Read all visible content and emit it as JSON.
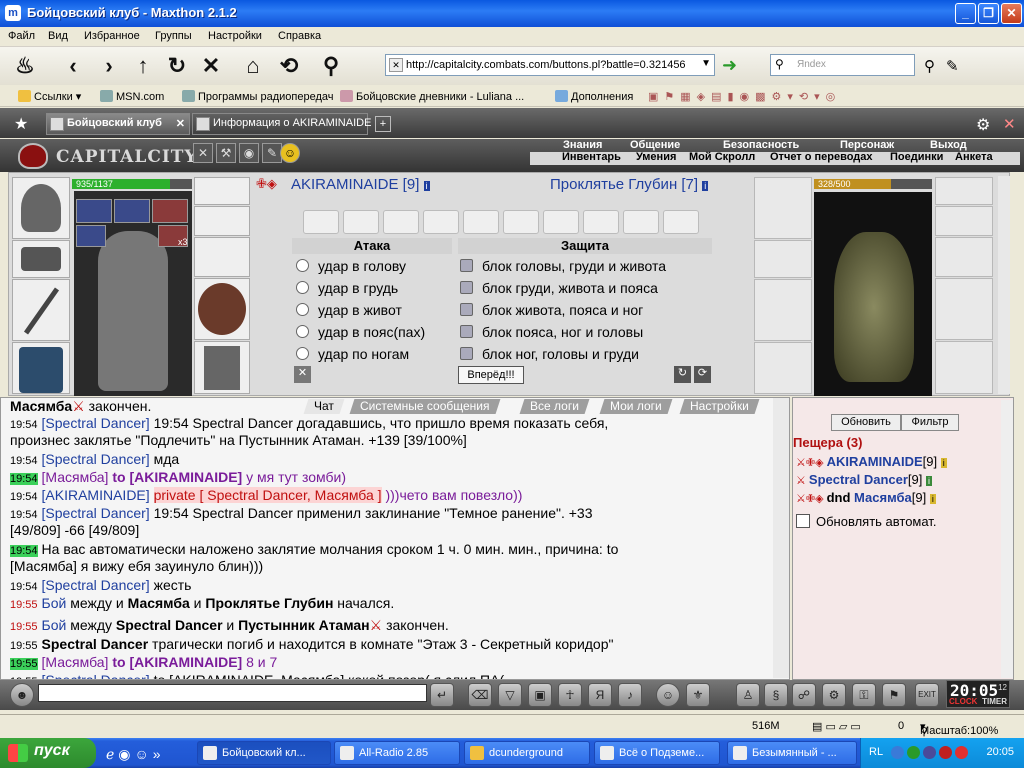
{
  "window": {
    "title": "Бойцовский клуб - Maxthon 2.1.2",
    "app_icon": "m"
  },
  "menu": [
    "Файл",
    "Вид",
    "Избранное",
    "Группы",
    "Настройки",
    "Справка"
  ],
  "address": {
    "url": "http://capitalcity.combats.com/buttons.pl?battle=0.321456"
  },
  "search": {
    "placeholder": "Яndex"
  },
  "bookmarks": [
    "Ссылки",
    "MSN.com",
    "Программы радиопередач",
    "Бойцовские дневники - Luliana ...",
    "Дополнения"
  ],
  "tabs": [
    {
      "label": "Бойцовский клуб",
      "active": true
    },
    {
      "label": "Информация о AKIRAMINAIDE",
      "active": false
    }
  ],
  "game": {
    "logo": "CAPITALCITY",
    "nav_top": [
      "Знания",
      "Общение",
      "Безопасность",
      "Персонаж",
      "Выход"
    ],
    "nav_bottom": [
      "Инвентарь",
      "Умения",
      "Мой Скролл",
      "Отчет о переводах",
      "Поединки",
      "Анкета"
    ],
    "player": {
      "name": "AKIRAMINAIDE [9]",
      "hp_text": "935/1137",
      "hp_fraction": 0.82,
      "potion_count": "x3"
    },
    "enemy": {
      "name": "Проклятье Глубин [7]",
      "hp_text": "328/500",
      "hp_fraction": 0.656
    },
    "attack_header": "Атака",
    "defense_header": "Защита",
    "attacks": [
      "удар в голову",
      "удар в грудь",
      "удар в живот",
      "удар в пояс(пах)",
      "удар по ногам"
    ],
    "blocks": [
      "блок головы, груди и живота",
      "блок груди, живота и пояса",
      "блок живота, пояса и ног",
      "блок пояса, ног и головы",
      "блок ног, головы и груди"
    ],
    "forward_button": "Вперёд!!!"
  },
  "chat": {
    "tabs": [
      "Чат",
      "Системные сообщения",
      "Все логи",
      "Мои логи",
      "Настройки"
    ]
  },
  "right_panel": {
    "refresh_button": "Обновить",
    "filter_button": "Фильтр",
    "location": "Пещера (3)",
    "players": [
      {
        "prefix": "",
        "name": "AKIRAMINAIDE",
        "level": "[9]"
      },
      {
        "prefix": "",
        "name": "Spectral Dancer",
        "level": "[9]"
      },
      {
        "prefix": "dnd",
        "name": "Масямба",
        "level": "[9]"
      }
    ],
    "auto_refresh_label": "Обновлять автомат."
  },
  "clock": {
    "time": "20:05",
    "seconds": "12",
    "label_left": "CLOCK",
    "label_right": "TIMER"
  },
  "status": {
    "memory": "516M",
    "count": "0",
    "zoom": "Масштаб:100%"
  },
  "taskbar": {
    "start": "пуск",
    "tasks": [
      "Бойцовский кл...",
      "All-Radio 2.85",
      "dcunderground",
      "Всё о Подземе...",
      "Безымянный - ..."
    ],
    "lang": "RL",
    "time": "20:05"
  },
  "colors": {
    "accent_blue": "#1f3f9f",
    "hp_green": "#2db02d",
    "time_green": "#3bd05a",
    "private_red": "#c01010"
  }
}
